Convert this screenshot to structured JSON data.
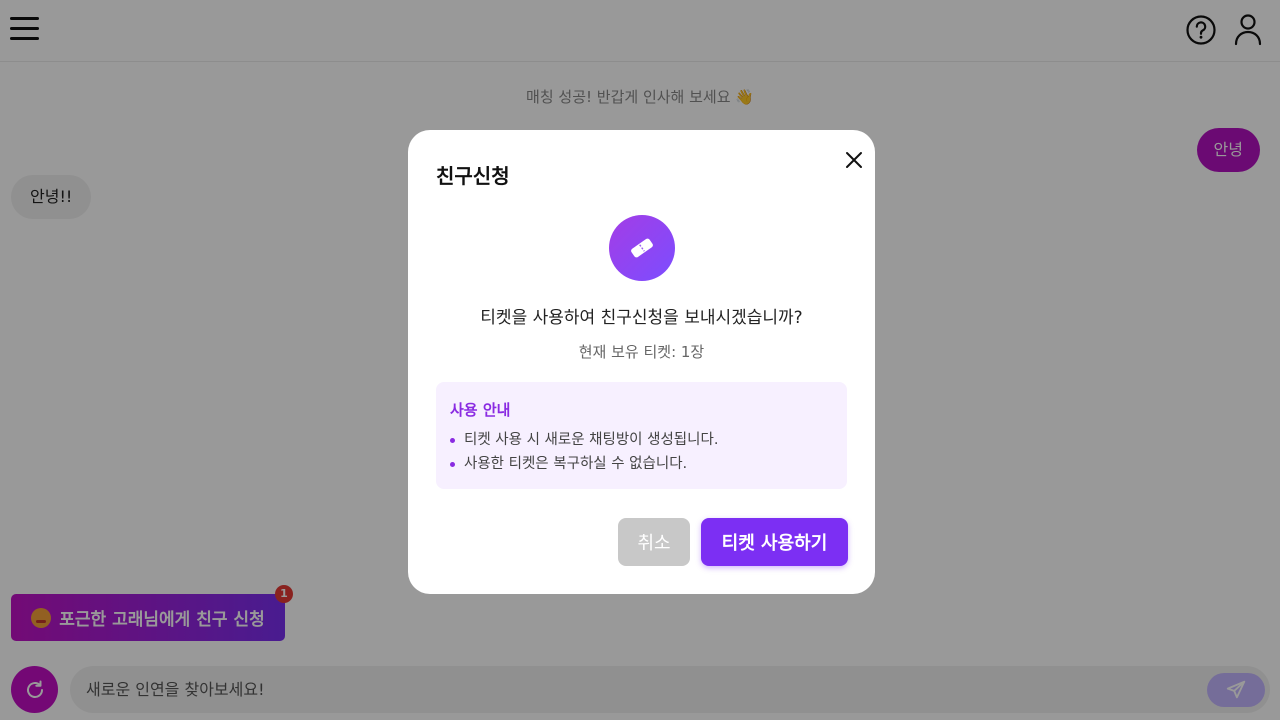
{
  "chat": {
    "system_message": "매칭 성공! 반갑게 인사해 보세요 👋",
    "messages": [
      {
        "side": "right",
        "text": "안녕"
      },
      {
        "side": "left",
        "text": "안녕!!"
      }
    ],
    "friend_request_button": "포근한 고래님에게 친구 신청",
    "friend_request_badge": "1",
    "input_placeholder": "새로운 인연을 찾아보세요!"
  },
  "modal": {
    "title": "친구신청",
    "question": "티켓을 사용하여 친구신청을 보내시겠습니까?",
    "holding": "현재 보유 티켓: 1장",
    "info_title": "사용 안내",
    "info_items": [
      "티켓 사용 시 새로운 채팅방이 생성됩니다.",
      "사용한 티켓은 복구하실 수 없습니다."
    ],
    "cancel_label": "취소",
    "confirm_label": "티켓 사용하기"
  },
  "colors": {
    "accent": "#7c2ff3",
    "brand_magenta": "#c10ec4",
    "info_bg": "#f7f0ff",
    "overlay": "rgba(0,0,0,0.4)"
  },
  "icons": {
    "menu": "menu-icon",
    "help": "help-circle-icon",
    "user": "user-icon",
    "close": "close-icon",
    "ticket": "ticket-icon",
    "refresh": "refresh-icon",
    "send": "send-icon"
  }
}
